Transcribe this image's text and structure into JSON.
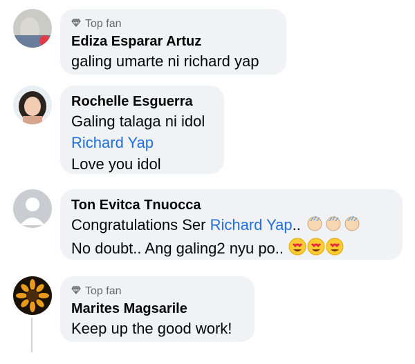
{
  "comments": [
    {
      "top_fan": "Top fan",
      "name": "Ediza Esparar Artuz",
      "lines": [
        "galing umarte ni richard yap"
      ]
    },
    {
      "name": "Rochelle Esguerra",
      "line1": "Galing talaga ni idol",
      "link": "Richard Yap",
      "line3": "Love you idol"
    },
    {
      "name": "Ton Evitca Tnuocca",
      "line1_prefix": "Congratulations Ser ",
      "line1_link": "Richard Yap",
      "line1_suffix": "..",
      "line2": "No doubt.. Ang galing2 nyu po..",
      "emoji1": "clapping-hands-emoji",
      "emoji2": "heart-eyes-emoji"
    },
    {
      "top_fan": "Top fan",
      "name": "Marites Magsarile",
      "lines": [
        "Keep up the good work!"
      ]
    }
  ],
  "colors": {
    "bubble": "#f0f2f5",
    "link": "#216fdb",
    "secondary_text": "#65676b"
  }
}
